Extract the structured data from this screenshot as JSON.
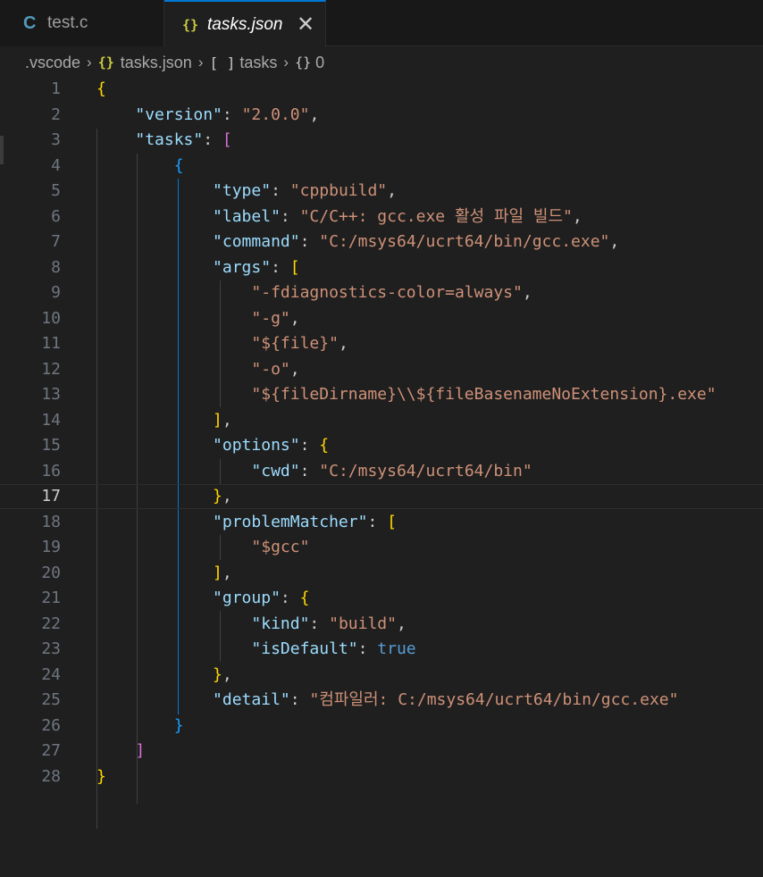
{
  "tabs": [
    {
      "icon": "c-file-icon",
      "icon_glyph": "C",
      "label": "test.c",
      "active": false
    },
    {
      "icon": "json-file-icon",
      "icon_glyph": "{}",
      "label": "tasks.json",
      "active": true,
      "close": "✕"
    }
  ],
  "breadcrumb": {
    "folder": ".vscode",
    "file_glyph": "{}",
    "file": "tasks.json",
    "array_glyph": "[ ]",
    "array": "tasks",
    "object_glyph": "{}",
    "object": "0",
    "separator": "›"
  },
  "editor": {
    "current_line": 17,
    "line_numbers": [
      "1",
      "2",
      "3",
      "4",
      "5",
      "6",
      "7",
      "8",
      "9",
      "10",
      "11",
      "12",
      "13",
      "14",
      "15",
      "16",
      "17",
      "18",
      "19",
      "20",
      "21",
      "22",
      "23",
      "24",
      "25",
      "26",
      "27",
      "28"
    ],
    "lines": [
      [
        {
          "t": "{",
          "c": "b1"
        }
      ],
      [
        {
          "t": "    "
        },
        {
          "t": "\"version\"",
          "c": "k"
        },
        {
          "t": ": ",
          "c": "p"
        },
        {
          "t": "\"2.0.0\"",
          "c": "s"
        },
        {
          "t": ",",
          "c": "p"
        }
      ],
      [
        {
          "t": "    "
        },
        {
          "t": "\"tasks\"",
          "c": "k"
        },
        {
          "t": ": ",
          "c": "p"
        },
        {
          "t": "[",
          "c": "b2"
        }
      ],
      [
        {
          "t": "        "
        },
        {
          "t": "{",
          "c": "b3"
        }
      ],
      [
        {
          "t": "            "
        },
        {
          "t": "\"type\"",
          "c": "k"
        },
        {
          "t": ": ",
          "c": "p"
        },
        {
          "t": "\"cppbuild\"",
          "c": "s"
        },
        {
          "t": ",",
          "c": "p"
        }
      ],
      [
        {
          "t": "            "
        },
        {
          "t": "\"label\"",
          "c": "k"
        },
        {
          "t": ": ",
          "c": "p"
        },
        {
          "t": "\"C/C++: gcc.exe 활성 파일 빌드\"",
          "c": "s"
        },
        {
          "t": ",",
          "c": "p"
        }
      ],
      [
        {
          "t": "            "
        },
        {
          "t": "\"command\"",
          "c": "k"
        },
        {
          "t": ": ",
          "c": "p"
        },
        {
          "t": "\"C:/msys64/ucrt64/bin/gcc.exe\"",
          "c": "s"
        },
        {
          "t": ",",
          "c": "p"
        }
      ],
      [
        {
          "t": "            "
        },
        {
          "t": "\"args\"",
          "c": "k"
        },
        {
          "t": ": ",
          "c": "p"
        },
        {
          "t": "[",
          "c": "b1"
        }
      ],
      [
        {
          "t": "                "
        },
        {
          "t": "\"-fdiagnostics-color=always\"",
          "c": "s"
        },
        {
          "t": ",",
          "c": "p"
        }
      ],
      [
        {
          "t": "                "
        },
        {
          "t": "\"-g\"",
          "c": "s"
        },
        {
          "t": ",",
          "c": "p"
        }
      ],
      [
        {
          "t": "                "
        },
        {
          "t": "\"${file}\"",
          "c": "s"
        },
        {
          "t": ",",
          "c": "p"
        }
      ],
      [
        {
          "t": "                "
        },
        {
          "t": "\"-o\"",
          "c": "s"
        },
        {
          "t": ",",
          "c": "p"
        }
      ],
      [
        {
          "t": "                "
        },
        {
          "t": "\"${fileDirname}\\\\${fileBasenameNoExtension}.exe\"",
          "c": "s"
        }
      ],
      [
        {
          "t": "            "
        },
        {
          "t": "]",
          "c": "b1"
        },
        {
          "t": ",",
          "c": "p"
        }
      ],
      [
        {
          "t": "            "
        },
        {
          "t": "\"options\"",
          "c": "k"
        },
        {
          "t": ": ",
          "c": "p"
        },
        {
          "t": "{",
          "c": "b1"
        }
      ],
      [
        {
          "t": "                "
        },
        {
          "t": "\"cwd\"",
          "c": "k"
        },
        {
          "t": ": ",
          "c": "p"
        },
        {
          "t": "\"C:/msys64/ucrt64/bin\"",
          "c": "s"
        }
      ],
      [
        {
          "t": "            "
        },
        {
          "t": "}",
          "c": "b1"
        },
        {
          "t": ",",
          "c": "p"
        }
      ],
      [
        {
          "t": "            "
        },
        {
          "t": "\"problemMatcher\"",
          "c": "k"
        },
        {
          "t": ": ",
          "c": "p"
        },
        {
          "t": "[",
          "c": "b1"
        }
      ],
      [
        {
          "t": "                "
        },
        {
          "t": "\"$gcc\"",
          "c": "s"
        }
      ],
      [
        {
          "t": "            "
        },
        {
          "t": "]",
          "c": "b1"
        },
        {
          "t": ",",
          "c": "p"
        }
      ],
      [
        {
          "t": "            "
        },
        {
          "t": "\"group\"",
          "c": "k"
        },
        {
          "t": ": ",
          "c": "p"
        },
        {
          "t": "{",
          "c": "b1"
        }
      ],
      [
        {
          "t": "                "
        },
        {
          "t": "\"kind\"",
          "c": "k"
        },
        {
          "t": ": ",
          "c": "p"
        },
        {
          "t": "\"build\"",
          "c": "s"
        },
        {
          "t": ",",
          "c": "p"
        }
      ],
      [
        {
          "t": "                "
        },
        {
          "t": "\"isDefault\"",
          "c": "k"
        },
        {
          "t": ": ",
          "c": "p"
        },
        {
          "t": "true",
          "c": "kw"
        }
      ],
      [
        {
          "t": "            "
        },
        {
          "t": "}",
          "c": "b1"
        },
        {
          "t": ",",
          "c": "p"
        }
      ],
      [
        {
          "t": "            "
        },
        {
          "t": "\"detail\"",
          "c": "k"
        },
        {
          "t": ": ",
          "c": "p"
        },
        {
          "t": "\"컴파일러: C:/msys64/ucrt64/bin/gcc.exe\"",
          "c": "s"
        }
      ],
      [
        {
          "t": "        "
        },
        {
          "t": "}",
          "c": "b3"
        }
      ],
      [
        {
          "t": "    "
        },
        {
          "t": "]",
          "c": "b2"
        }
      ],
      [
        {
          "t": "}",
          "c": "b1"
        }
      ]
    ]
  },
  "colors": {
    "background": "#1f1f1f",
    "active_tab_accent": "#0078d4",
    "json_key": "#9cdcfe",
    "json_string": "#ce9178",
    "bracket_gold": "#ffd700",
    "bracket_magenta": "#da70d6",
    "bracket_blue": "#179fff",
    "keyword": "#569cd6"
  }
}
